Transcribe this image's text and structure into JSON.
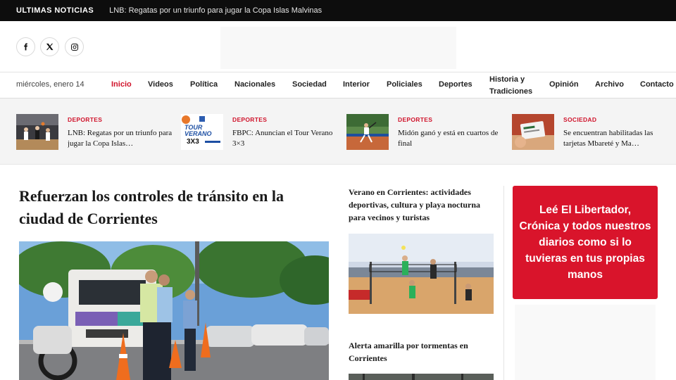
{
  "ticker": {
    "label": "ULTIMAS NOTICIAS",
    "headline": "LNB: Regatas por un triunfo para jugar la Copa Islas Malvinas"
  },
  "social": [
    "facebook-icon",
    "x-twitter-icon",
    "instagram-icon"
  ],
  "nav": {
    "date": "miércoles, enero 14",
    "items": [
      "Inicio",
      "Videos",
      "Política",
      "Nacionales",
      "Sociedad",
      "Interior",
      "Policiales",
      "Deportes",
      "Historia y Tradiciones",
      "Opinión",
      "Archivo",
      "Contacto"
    ],
    "historia_line1": "Historia y",
    "historia_line2": "Tradiciones",
    "active": "Inicio"
  },
  "featured": [
    {
      "category": "DEPORTES",
      "title": "LNB: Regatas por un triunfo para jugar la Copa Islas…"
    },
    {
      "category": "DEPORTES",
      "title": "FBPC: Anuncian el Tour Verano 3×3"
    },
    {
      "category": "DEPORTES",
      "title": "Midón ganó y está en cuartos de final"
    },
    {
      "category": "SOCIEDAD",
      "title": "Se encuentran habilitadas las tarjetas Mbareté y Ma…"
    }
  ],
  "lead": {
    "title": "Refuerzan los controles de tránsito en la ciudad de Corrientes"
  },
  "column2": [
    {
      "title": "Verano en Corrientes: actividades deportivas, cultura y playa nocturna para vecinos y turistas"
    },
    {
      "title": "Alerta amarilla por tormentas en Corrientes"
    }
  ],
  "promo": {
    "text": "Leé El Libertador, Crónica y todos nuestros diarios como si lo tuvieras en tus propias manos"
  },
  "images": {
    "tour_line1": "TOUR",
    "tour_line2": "VERANO",
    "tour_line3": "3X3"
  },
  "colors": {
    "accent": "#d0132b",
    "ticker_bg": "#0d0d0d",
    "promo_bg": "#d9142b"
  }
}
